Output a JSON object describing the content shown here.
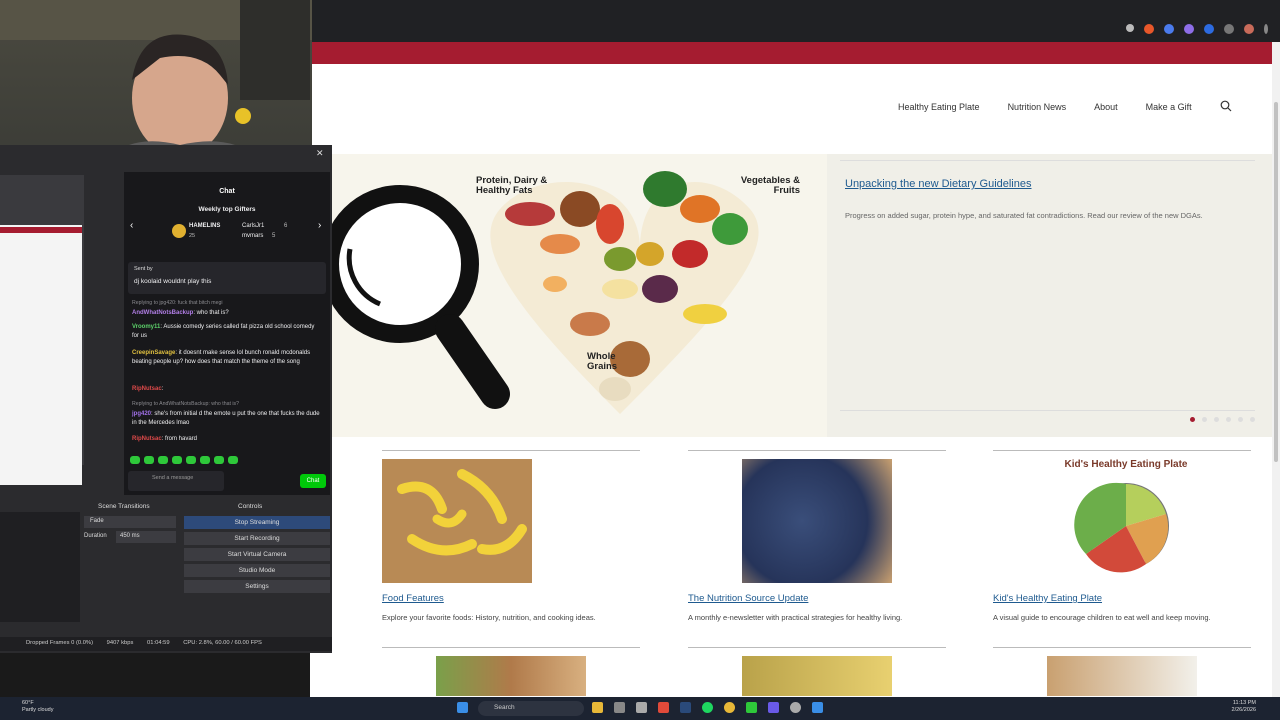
{
  "site": {
    "nav": [
      "Healthy Eating Plate",
      "Nutrition News",
      "About",
      "Make a Gift"
    ],
    "hero": {
      "title": "Unpacking the new Dietary Guidelines",
      "description": "Progress on added sugar, protein hype, and saturated fat contradictions. Read our review of the new DGAs.",
      "labels": {
        "protein": "Protein, Dairy & Healthy Fats",
        "vegetables": "Vegetables & Fruits",
        "grains": "Whole Grains"
      },
      "slides": 6
    },
    "cards": [
      {
        "title": "Food Features",
        "desc": "Explore your favorite foods: History, nutrition, and cooking ideas."
      },
      {
        "title": "The Nutrition Source Update",
        "desc": "A monthly e-newsletter with practical strategies for healthy living."
      },
      {
        "title": "Kid's Healthy Eating Plate",
        "desc": "A visual guide to encourage children to eat well and keep moving.",
        "image_title": "Kid's Healthy Eating Plate"
      }
    ]
  },
  "obs": {
    "chat_title": "Chat",
    "gifters_title": "Weekly top Gifters",
    "gifters": [
      {
        "name": "HAMELINS",
        "count": "25"
      },
      {
        "name": "CarlsJr1",
        "count": "6"
      },
      {
        "name": "mvmars",
        "count": "5"
      }
    ],
    "pinned": {
      "sent_by": "Sent by",
      "message": "dj koolaid wouldnt play this"
    },
    "messages": [
      {
        "user": "",
        "text": "Replying to jpg420: fuck that bitch megi"
      },
      {
        "user": "AndWhatNotsBackup",
        "text": ": who that is?"
      },
      {
        "user": "Vroomy11",
        "text": ": Aussie comedy series called fat pizza old school comedy for us"
      },
      {
        "user": "CreepinSavage",
        "text": ": it doesnt make sense lol bunch ronald mcdonalds beating people up? how does that match the theme of the song"
      },
      {
        "user": "RipNutsac",
        "text": ":"
      },
      {
        "user": "",
        "text": "Replying to AndWhatNotsBackup: who that is?"
      },
      {
        "user": "jpg420",
        "text": ": she's from initial d the emote u put the one that fucks the dude in the Mercedes lmao"
      },
      {
        "user": "RipNutsac",
        "text": ": from havard"
      }
    ],
    "send_placeholder": "Send a message",
    "chat_button": "Chat",
    "scene_transitions": "Scene Transitions",
    "transition": "Fade",
    "duration_label": "Duration",
    "duration": "450 ms",
    "controls_title": "Controls",
    "controls": [
      "Stop Streaming",
      "Start Recording",
      "Start Virtual Camera",
      "Studio Mode",
      "Settings"
    ],
    "status": {
      "dropped": "Dropped Frames 0 (0.0%)",
      "kbps": "9407 kbps",
      "time": "01:04:59",
      "cpu": "CPU: 2.8%, 60.00 / 60.00 FPS"
    }
  },
  "taskbar": {
    "weather_temp": "60°F",
    "weather_desc": "Partly cloudy",
    "search": "Search",
    "time": "11:13 PM",
    "date": "2/26/2026"
  },
  "colors": {
    "accent": "#a51c30",
    "link": "#1e5a8f",
    "obs_green": "#00c80a"
  }
}
